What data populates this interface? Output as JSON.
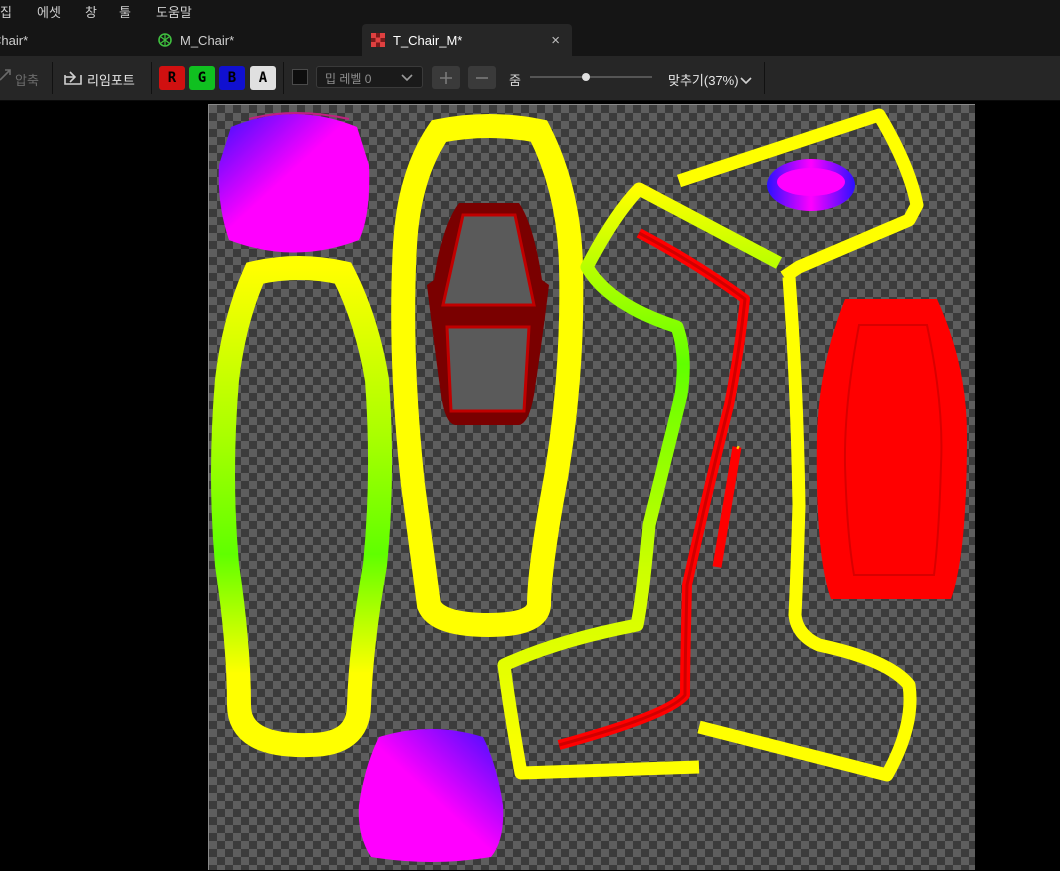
{
  "menu": {
    "items": [
      "집",
      "에셋",
      "창",
      "툴",
      "도움말"
    ]
  },
  "tabs": [
    {
      "label": "Chair*",
      "icon": "material-icon"
    },
    {
      "label": "M_Chair*",
      "icon": "material-icon"
    },
    {
      "label": "T_Chair_M*",
      "icon": "texture-icon",
      "active": true,
      "close": "×"
    }
  ],
  "toolbar": {
    "compress_label": "압축",
    "reimport_label": "리임포트",
    "channels": [
      {
        "label": "R",
        "color": "#d01010"
      },
      {
        "label": "G",
        "color": "#10c020"
      },
      {
        "label": "B",
        "color": "#1010d0"
      },
      {
        "label": "A",
        "color": "#e0e0e0"
      }
    ],
    "mip_level": "밉 레벨 0",
    "zoom_label": "줌",
    "zoom_value": 37,
    "fit_label": "맞추기(37%)"
  },
  "texture": {
    "name": "T_Chair_M",
    "colors": {
      "yellow": "#ffff00",
      "red": "#ff0000",
      "magenta": "#ff00ff",
      "blue": "#2010ff",
      "green": "#40ff00",
      "dark_red": "#8a0000"
    }
  }
}
